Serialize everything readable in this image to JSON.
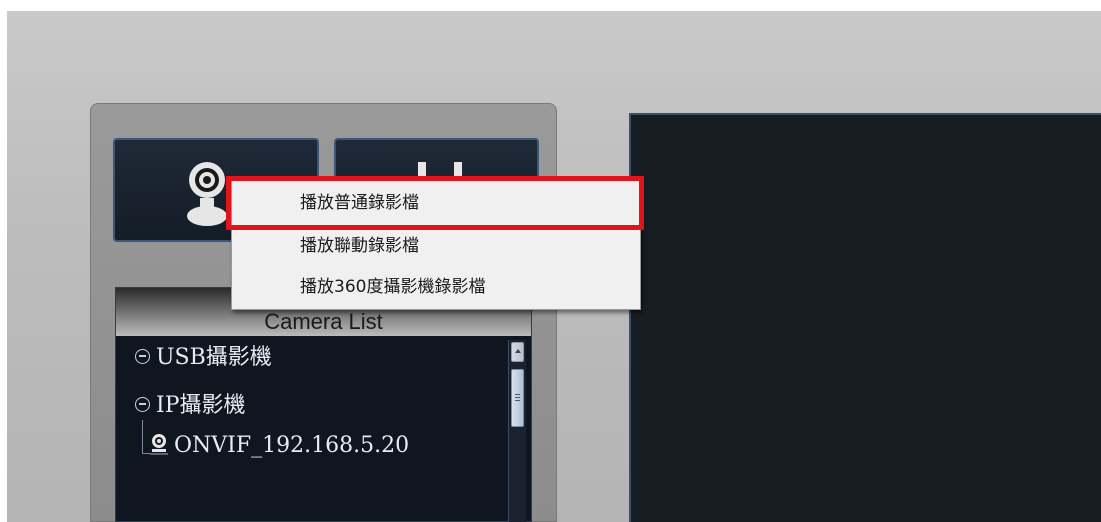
{
  "camera_panel": {
    "tiles": {
      "camera_icon": "webcam-icon",
      "playback_icon": "playback-icon"
    },
    "camera_list": {
      "title": "Camera List",
      "tree": {
        "usb_group": "USB攝影機",
        "ip_group": "IP攝影機",
        "ip_cameras": [
          {
            "name": "ONVIF_192.168.5.20"
          }
        ]
      }
    }
  },
  "context_menu": {
    "items": [
      {
        "label": "播放普通錄影檔",
        "highlighted": true
      },
      {
        "label": "播放聯動錄影檔",
        "highlighted": false
      },
      {
        "label": "播放360度攝影機錄影檔",
        "highlighted": false
      }
    ],
    "highlight_color": "#e1141b"
  },
  "colors": {
    "panel_dark": "#10161f",
    "tile_border": "#3b5678",
    "video_bg": "#171d23"
  }
}
